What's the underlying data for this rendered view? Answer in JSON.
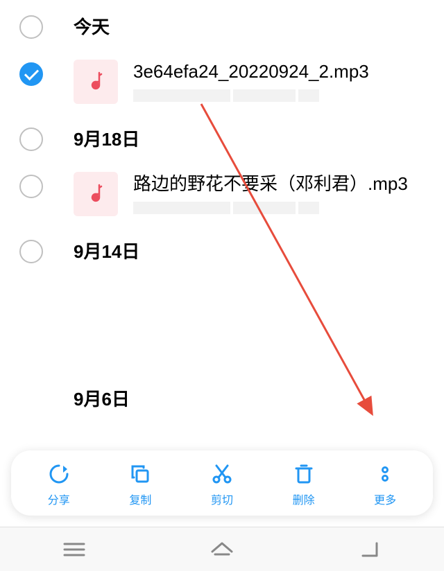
{
  "sections": [
    {
      "label": "今天"
    },
    {
      "label": "9月18日"
    },
    {
      "label": "9月14日"
    },
    {
      "label": "9月6日"
    }
  ],
  "files": [
    {
      "name": "3e64efa24_20220924_2.mp3"
    },
    {
      "name": "路边的野花不要采（邓利君）.mp3"
    }
  ],
  "toolbar": {
    "share": "分享",
    "copy": "复制",
    "cut": "剪切",
    "delete": "删除",
    "more": "更多"
  },
  "colors": {
    "accent": "#2196F3",
    "arrow": "#e74c3c"
  }
}
